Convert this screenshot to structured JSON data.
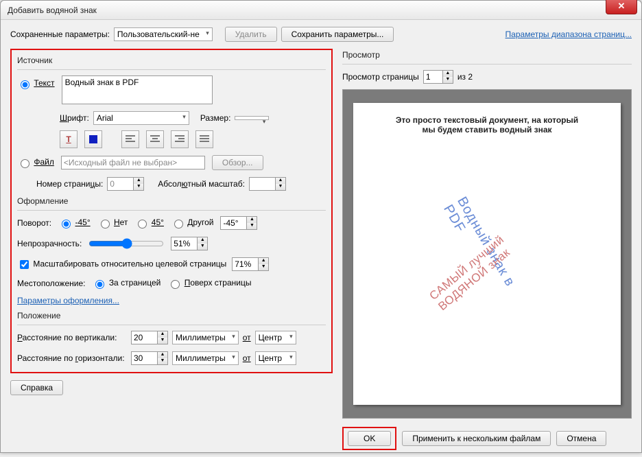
{
  "titlebar": {
    "title": "Добавить водяной знак"
  },
  "toprow": {
    "saved_label": "Сохраненные параметры:",
    "saved_value": "Пользовательский-не",
    "delete_btn": "Удалить",
    "save_btn": "Сохранить параметры...",
    "page_range_link": "Параметры диапазона страниц..."
  },
  "source": {
    "group_label": "Источник",
    "text_radio": "Текст",
    "text_value": "Водный знак в PDF",
    "font_label": "Шрифт:",
    "font_value": "Arial",
    "size_label": "Размер:",
    "size_value": "",
    "file_radio": "Файл",
    "file_value": "<Исходный файл не выбран>",
    "browse_btn": "Обзор...",
    "page_num_label": "Номер страницы:",
    "page_num_value": "0",
    "abs_scale_label": "Абсолютный масштаб:",
    "abs_scale_value": ""
  },
  "design": {
    "group_label": "Оформление",
    "rotate_label": "Поворот:",
    "rot_m45": "-45°",
    "rot_none": "Нет",
    "rot_45": "45°",
    "rot_other": "Другой",
    "rot_other_value": "-45°",
    "opacity_label": "Непрозрачность:",
    "opacity_value": "51%",
    "scale_check": "Масштабировать относительно целевой страницы",
    "scale_value": "71%",
    "location_label": "Местоположение:",
    "loc_behind": "За страницей",
    "loc_over": "Поверх страницы",
    "design_params_link": "Параметры оформления..."
  },
  "position": {
    "group_label": "Положение",
    "vdist_label": "Расстояние по вертикали:",
    "vdist_value": "20",
    "hdist_label": "Расстояние по горизонтали:",
    "hdist_value": "30",
    "unit_value": "Миллиметры",
    "from_label": "от",
    "from_value": "Центр"
  },
  "preview": {
    "group_label": "Просмотр",
    "page_label": "Просмотр страницы",
    "page_value": "1",
    "of_label": "из 2",
    "doc_text_1": "Это просто текстовый документ, на который",
    "doc_text_2": "мы будем ставить водный знак",
    "watermark1": "Водный знак в PDF",
    "watermark2": "САМЫЙ лучший ВОДЯНОЙ знак"
  },
  "buttons": {
    "help": "Справка",
    "ok": "OK",
    "apply_multi": "Применить к нескольким файлам",
    "cancel": "Отмена"
  }
}
